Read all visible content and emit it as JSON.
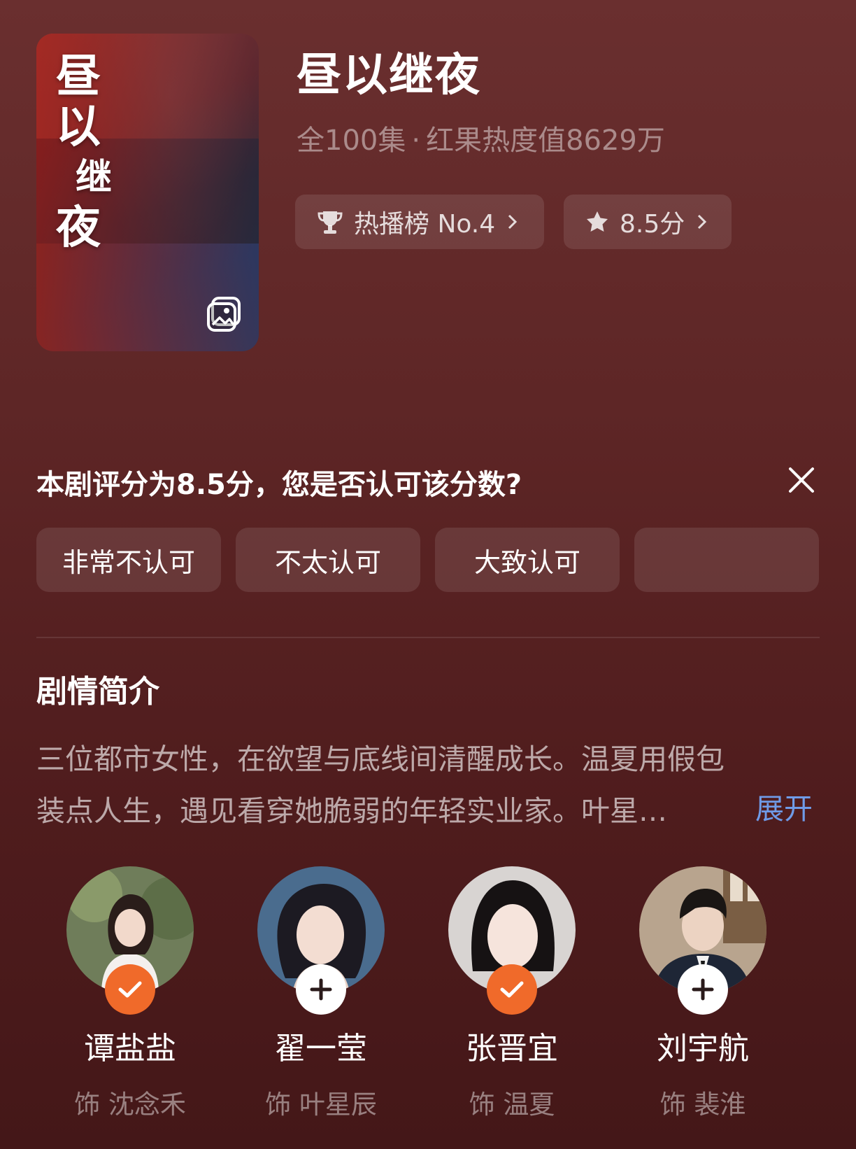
{
  "header": {
    "poster": {
      "title_chars": [
        "昼",
        "以",
        "继",
        "夜"
      ]
    },
    "title": "昼以继夜",
    "episodes": "全100集",
    "separator": "·",
    "popularity": "红果热度值8629万",
    "rank_pill": {
      "label": "热播榜 No.4",
      "icon": "trophy-icon"
    },
    "score_pill": {
      "label": "8.5分",
      "icon": "star-icon"
    }
  },
  "rating_prompt": {
    "question": "本剧评分为8.5分，您是否认可该分数?",
    "options": [
      "非常不认可",
      "不太认可",
      "大致认可",
      ""
    ]
  },
  "synopsis": {
    "title": "剧情简介",
    "line1": "三位都市女性，在欲望与底线间清醒成长。温夏用假包",
    "line2": "装点人生，遇见看穿她脆弱的年轻实业家。叶星…",
    "expand_label": "展开"
  },
  "cast": [
    {
      "name": "谭盐盐",
      "role": "饰 沈念禾",
      "status": "followed"
    },
    {
      "name": "翟一莹",
      "role": "饰 叶星辰",
      "status": "add"
    },
    {
      "name": "张晋宜",
      "role": "饰 温夏",
      "status": "followed"
    },
    {
      "name": "刘宇航",
      "role": "饰 裴淮",
      "status": "add"
    }
  ],
  "colors": {
    "background_top": "#6a2f2f",
    "background_bottom": "#441718",
    "follow_badge": "#f06a2a",
    "expand_link": "#6f9be8"
  }
}
